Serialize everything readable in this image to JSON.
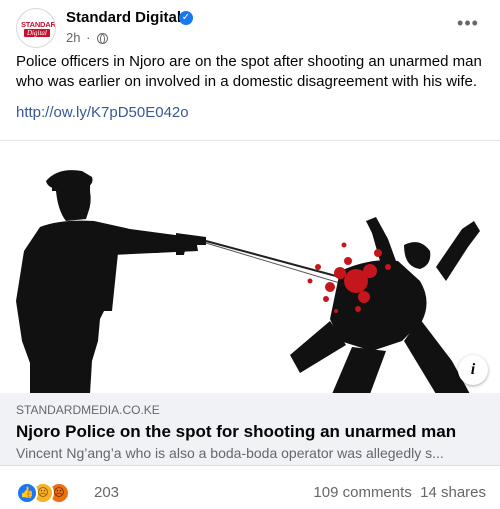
{
  "post": {
    "page_name": "Standard Digital",
    "time": "2h",
    "avatar_top": "STANDARD",
    "avatar_bottom": "Digital",
    "text": "Police officers in Njoro are on the spot after shooting an unarmed man who was earlier on involved in a domestic disagreement with his wife.",
    "link": "http://ow.ly/K7pD50E042o",
    "more_icon": "•••"
  },
  "link_card": {
    "domain": "STANDARDMEDIA.CO.KE",
    "title": "Njoro Police on the spot for shooting an unarmed man",
    "description": "Vincent Ng’ang’a who is also a boda-boda operator was allegedly s..."
  },
  "footer": {
    "reaction_count": "203",
    "comments_shares": "109 comments  14 shares"
  },
  "colors": {
    "accent": "#1877f2",
    "link": "#385898",
    "blood": "#c4161c"
  }
}
